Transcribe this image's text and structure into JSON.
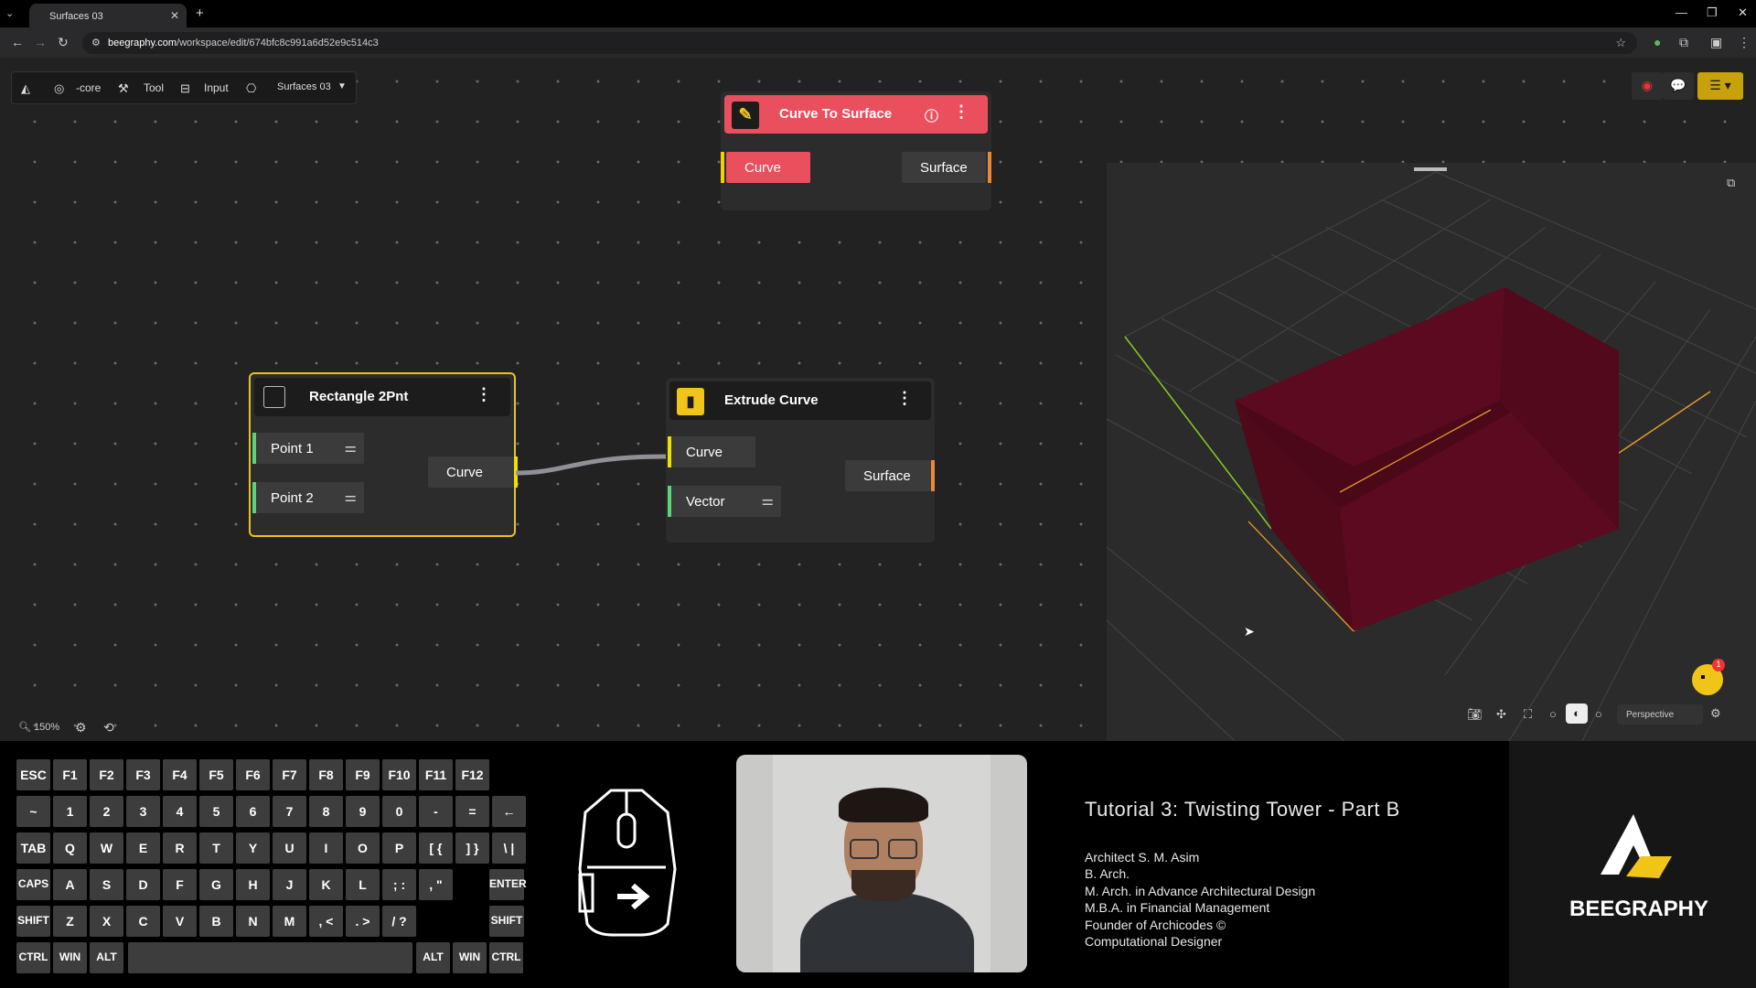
{
  "browser": {
    "tab_title": "Surfaces 03",
    "url_domain": "beegraphy.com",
    "url_path": "/workspace/edit/674bfc8c991a6d52e9c514c3"
  },
  "toolbar": {
    "core": "-core",
    "tool": "Tool",
    "input": "Input",
    "workspace": "Surfaces 03"
  },
  "nodes": {
    "curve_to_surface": {
      "title": "Curve To Surface",
      "input": "Curve",
      "output": "Surface"
    },
    "rectangle": {
      "title": "Rectangle 2Pnt",
      "input1": "Point 1",
      "input2": "Point 2",
      "output": "Curve"
    },
    "extrude": {
      "title": "Extrude Curve",
      "input1": "Curve",
      "input2": "Vector",
      "output": "Surface"
    }
  },
  "canvas": {
    "zoom": "150%"
  },
  "viewport": {
    "camera": "Perspective",
    "shape_color": "#5c0a1f",
    "notification_count": "1"
  },
  "keyboard": {
    "row1": [
      "ESC",
      "F1",
      "F2",
      "F3",
      "F4",
      "F5",
      "F6",
      "F7",
      "F8",
      "F9",
      "F10",
      "F11",
      "F12"
    ],
    "row2": [
      "~",
      "1",
      "2",
      "3",
      "4",
      "5",
      "6",
      "7",
      "8",
      "9",
      "0",
      "-",
      "=",
      "←"
    ],
    "row3": [
      "TAB",
      "Q",
      "W",
      "E",
      "R",
      "T",
      "Y",
      "U",
      "I",
      "O",
      "P",
      "[ {",
      "] }",
      "\\ |"
    ],
    "row4": [
      "CAPS",
      "A",
      "S",
      "D",
      "F",
      "G",
      "H",
      "J",
      "K",
      "L",
      "; :",
      ", \"",
      "ENTER"
    ],
    "row5": [
      "SHIFT",
      "Z",
      "X",
      "C",
      "V",
      "B",
      "N",
      "M",
      ", <",
      ". >",
      "/ ?",
      "SHIFT"
    ],
    "row6": [
      "CTRL",
      "WIN",
      "ALT",
      "ALT",
      "WIN",
      "CTRL"
    ]
  },
  "tutorial": {
    "title": "Tutorial 3: Twisting Tower - Part B",
    "lines": [
      "Architect S. M. Asim",
      "B. Arch.",
      "M. Arch. in Advance Architectural Design",
      "M.B.A. in Financial Management",
      "Founder of Archicodes ©",
      "Computational Designer"
    ]
  },
  "brand": {
    "name": "BEEGRAPHY"
  }
}
